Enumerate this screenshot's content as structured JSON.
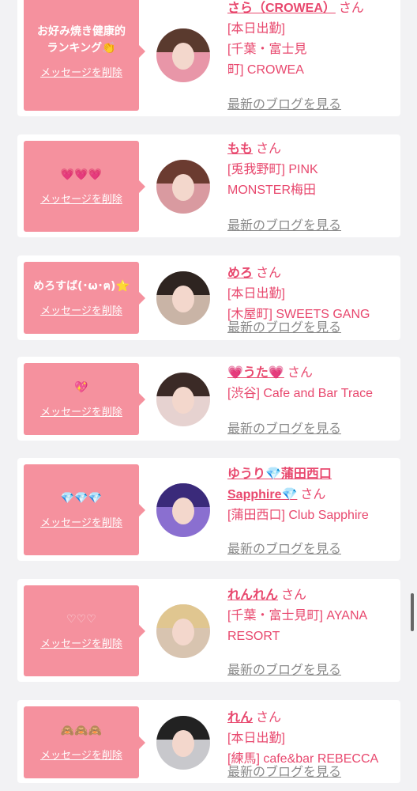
{
  "common": {
    "delete_label": "メッセージを削除",
    "blog_label": "最新のブログを見る",
    "san": "さん"
  },
  "entries": [
    {
      "message": "お好み焼き健康的\nランキング👏",
      "name": "さら（CROWEA）",
      "location": "[本日出勤]\n[千葉・富士見\n町] CROWEA"
    },
    {
      "message": "💗💗💗",
      "name": "もも",
      "location": "[兎我野町] PINK\nMONSTER梅田"
    },
    {
      "message": "めろすば(･ω･ฅ)⭐",
      "name": "めろ",
      "location": "[本日出勤]\n[木屋町] SWEETS GANG"
    },
    {
      "message": "💖",
      "name": "💗うた💗",
      "location": "[渋谷] Cafe and Bar Trace"
    },
    {
      "message": "💎💎💎",
      "name": "ゆうり💎蒲田西口\nSapphire💎",
      "location": "[蒲田西口] Club Sapphire"
    },
    {
      "message": "♡♡♡",
      "name": "れんれん",
      "location": "[千葉・富士見町] AYANA\nRESORT"
    },
    {
      "message": "🙈🙈🙈",
      "name": "れん",
      "location": "[本日出勤]\n[練馬] cafe&bar REBECCA"
    }
  ]
}
